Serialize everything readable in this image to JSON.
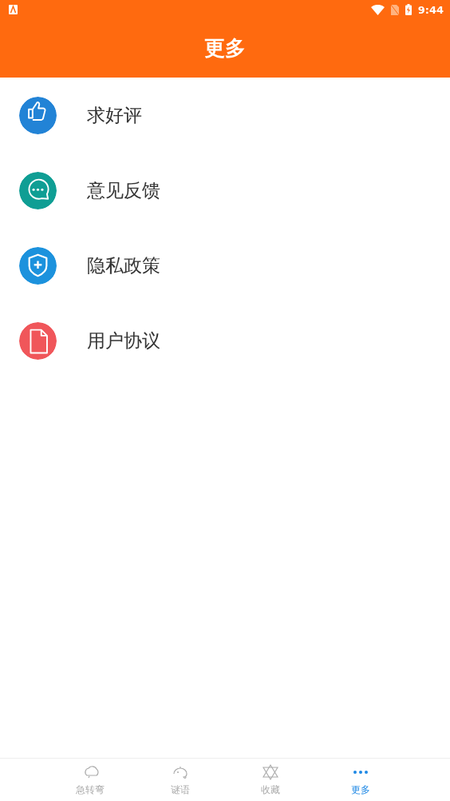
{
  "status_bar": {
    "time": "9:44"
  },
  "header": {
    "title": "更多"
  },
  "items": [
    {
      "label": "求好评",
      "kind": "thumb",
      "color": "#2283d6"
    },
    {
      "label": "意见反馈",
      "kind": "chat",
      "color": "#0f9e94"
    },
    {
      "label": "隐私政策",
      "kind": "shield",
      "color": "#1c92dd"
    },
    {
      "label": "用户协议",
      "kind": "document",
      "color": "#f0565a"
    }
  ],
  "tabs": [
    {
      "label": "急转弯",
      "kind": "cloud",
      "selected": false
    },
    {
      "label": "谜语",
      "kind": "animal",
      "selected": false
    },
    {
      "label": "收藏",
      "kind": "star",
      "selected": false
    },
    {
      "label": "更多",
      "kind": "dots",
      "selected": true
    }
  ]
}
